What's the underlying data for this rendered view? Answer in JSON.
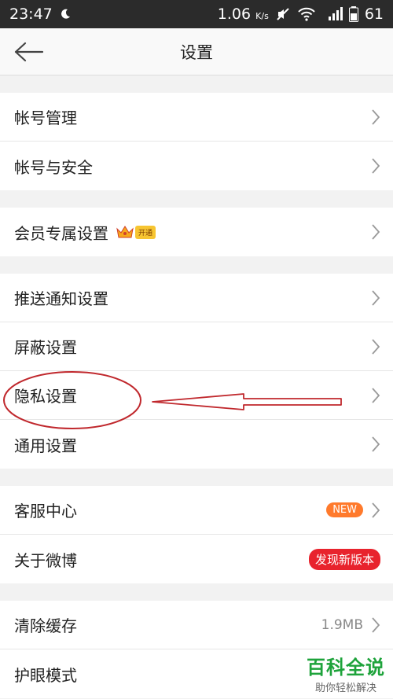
{
  "status_bar": {
    "time": "23:47",
    "speed": "1.06",
    "speed_unit": "K/s",
    "battery": "61"
  },
  "nav": {
    "title": "设置"
  },
  "groups": [
    {
      "items": [
        {
          "label": "帐号管理"
        },
        {
          "label": "帐号与安全"
        }
      ]
    },
    {
      "items": [
        {
          "label": "会员专属设置",
          "badge": "开通"
        }
      ]
    },
    {
      "items": [
        {
          "label": "推送通知设置"
        },
        {
          "label": "屏蔽设置"
        },
        {
          "label": "隐私设置"
        },
        {
          "label": "通用设置"
        }
      ]
    },
    {
      "items": [
        {
          "label": "客服中心",
          "badge": "NEW"
        },
        {
          "label": "关于微博",
          "badge": "发现新版本"
        }
      ]
    },
    {
      "items": [
        {
          "label": "清除缓存",
          "value": "1.9MB"
        },
        {
          "label": "护眼模式"
        }
      ]
    }
  ],
  "watermark": {
    "title": "百科全说",
    "subtitle": "助你轻松解决"
  },
  "colors": {
    "annotation": "#c0282d",
    "new_badge": "#ff7a2c",
    "update_badge": "#e8232d",
    "watermark_green": "#1ea33b"
  }
}
